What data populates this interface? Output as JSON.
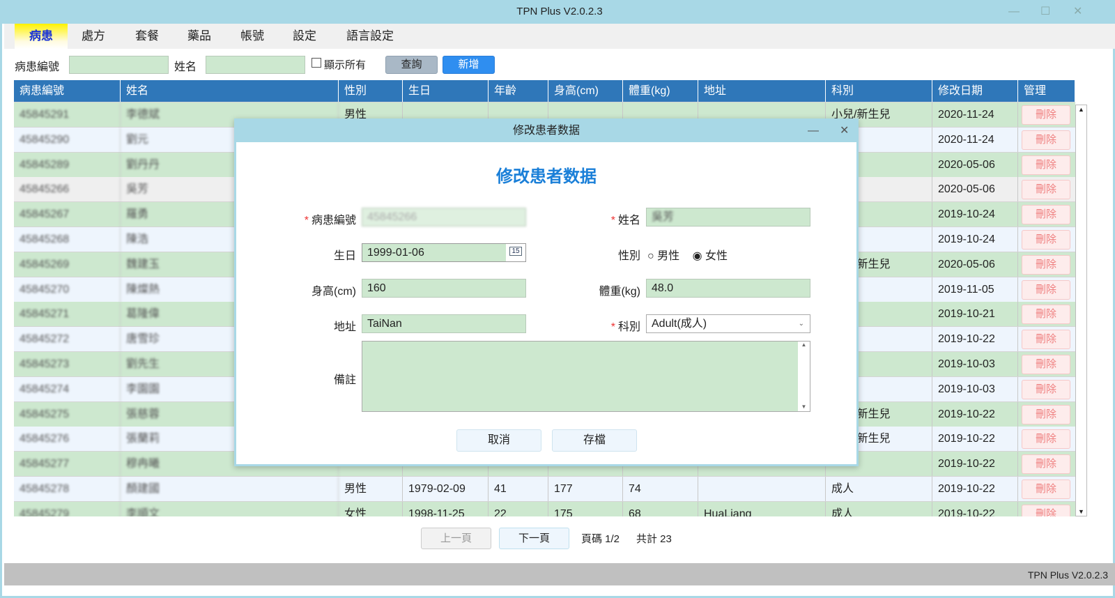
{
  "window": {
    "title": "TPN Plus V2.0.2.3"
  },
  "menu": [
    {
      "label": "病患",
      "active": true
    },
    {
      "label": "處方"
    },
    {
      "label": "套餐"
    },
    {
      "label": "藥品"
    },
    {
      "label": "帳號"
    },
    {
      "label": "設定"
    },
    {
      "label": "語言設定"
    }
  ],
  "search": {
    "id_label": "病患編號",
    "id_value": "",
    "name_label": "姓名",
    "name_value": "",
    "show_all_label": "顯示所有",
    "show_all_checked": false,
    "query_label": "查詢",
    "add_label": "新增"
  },
  "table": {
    "headers": [
      "病患編號",
      "姓名",
      "性別",
      "生日",
      "年齡",
      "身高(cm)",
      "體重(kg)",
      "地址",
      "科別",
      "修改日期",
      "管理"
    ],
    "delete_label": "刪除",
    "rows": [
      {
        "id": "45845291",
        "name": "李德斌",
        "gender": "男性",
        "birth": "",
        "age": "",
        "height": "",
        "weight": "",
        "address": "",
        "dept": "小兒/新生兒",
        "modified": "2020-11-24"
      },
      {
        "id": "45845290",
        "name": "劉元",
        "gender": "",
        "birth": "",
        "age": "",
        "height": "",
        "weight": "",
        "address": "",
        "dept": "",
        "modified": "2020-11-24"
      },
      {
        "id": "45845289",
        "name": "劉丹丹",
        "gender": "",
        "birth": "",
        "age": "",
        "height": "",
        "weight": "",
        "address": "",
        "dept": "",
        "modified": "2020-05-06"
      },
      {
        "id": "45845266",
        "name": "吳芳",
        "gender": "",
        "birth": "",
        "age": "",
        "height": "",
        "weight": "",
        "address": "",
        "dept": "",
        "modified": "2020-05-06",
        "selected": true
      },
      {
        "id": "45845267",
        "name": "羅勇",
        "gender": "",
        "birth": "",
        "age": "",
        "height": "",
        "weight": "",
        "address": "",
        "dept": "",
        "modified": "2019-10-24"
      },
      {
        "id": "45845268",
        "name": "陳浩",
        "gender": "",
        "birth": "",
        "age": "",
        "height": "",
        "weight": "",
        "address": "",
        "dept": "",
        "modified": "2019-10-24"
      },
      {
        "id": "45845269",
        "name": "魏建玉",
        "gender": "",
        "birth": "",
        "age": "",
        "height": "",
        "weight": "",
        "address": "",
        "dept": "小兒/新生兒",
        "modified": "2020-05-06"
      },
      {
        "id": "45845270",
        "name": "陳燦熱",
        "gender": "",
        "birth": "",
        "age": "",
        "height": "",
        "weight": "",
        "address": "",
        "dept": "",
        "modified": "2019-11-05"
      },
      {
        "id": "45845271",
        "name": "葛隆偉",
        "gender": "",
        "birth": "",
        "age": "",
        "height": "",
        "weight": "",
        "address": "",
        "dept": "",
        "modified": "2019-10-21"
      },
      {
        "id": "45845272",
        "name": "唐雪珍",
        "gender": "",
        "birth": "",
        "age": "",
        "height": "",
        "weight": "",
        "address": "",
        "dept": "",
        "modified": "2019-10-22"
      },
      {
        "id": "45845273",
        "name": "劉先生",
        "gender": "",
        "birth": "",
        "age": "",
        "height": "",
        "weight": "",
        "address": "",
        "dept": "",
        "modified": "2019-10-03"
      },
      {
        "id": "45845274",
        "name": "李園園",
        "gender": "",
        "birth": "",
        "age": "",
        "height": "",
        "weight": "",
        "address": "",
        "dept": "",
        "modified": "2019-10-03"
      },
      {
        "id": "45845275",
        "name": "張慈蓉",
        "gender": "",
        "birth": "",
        "age": "",
        "height": "",
        "weight": "",
        "address": "",
        "dept": "小兒/新生兒",
        "modified": "2019-10-22"
      },
      {
        "id": "45845276",
        "name": "張蘭莉",
        "gender": "",
        "birth": "",
        "age": "",
        "height": "",
        "weight": "",
        "address": "",
        "dept": "小兒/新生兒",
        "modified": "2019-10-22"
      },
      {
        "id": "45845277",
        "name": "穆冉曦",
        "gender": "",
        "birth": "",
        "age": "",
        "height": "",
        "weight": "",
        "address": "",
        "dept": "",
        "modified": "2019-10-22"
      },
      {
        "id": "45845278",
        "name": "顏建國",
        "gender": "男性",
        "birth": "1979-02-09",
        "age": "41",
        "height": "177",
        "weight": "74",
        "address": "",
        "dept": "成人",
        "modified": "2019-10-22"
      },
      {
        "id": "45845279",
        "name": "李順文",
        "gender": "女性",
        "birth": "1998-11-25",
        "age": "22",
        "height": "175",
        "weight": "68",
        "address": "HuaLiang",
        "dept": "成人",
        "modified": "2019-10-22"
      }
    ]
  },
  "pager": {
    "prev_label": "上一頁",
    "next_label": "下一頁",
    "page_text": "頁碼 1/2",
    "total_text": "共計 23"
  },
  "status": {
    "version": "TPN Plus V2.0.2.3"
  },
  "modal": {
    "window_title": "修改患者数据",
    "heading": "修改患者数据",
    "id_label": "病患編號",
    "id_value": "45845266",
    "name_label": "姓名",
    "name_value": "吳芳",
    "birth_label": "生日",
    "birth_value": "1999-01-06",
    "calendar_day": "15",
    "gender_label": "性別",
    "gender_options": [
      "男性",
      "女性"
    ],
    "gender_selected": "女性",
    "height_label": "身高(cm)",
    "height_value": "160",
    "weight_label": "體重(kg)",
    "weight_value": "48.0",
    "address_label": "地址",
    "address_value": "TaiNan",
    "dept_label": "科別",
    "dept_value": "Adult(成人)",
    "note_label": "備註",
    "note_value": "",
    "cancel_label": "取消",
    "save_label": "存檔"
  },
  "colors": {
    "header": "#2f77b9",
    "row_green": "#cde8cf",
    "row_blue": "#eef5fd",
    "row_selected": "#efefef",
    "accent": "#2f8ef0",
    "title": "#1a7fd8"
  }
}
